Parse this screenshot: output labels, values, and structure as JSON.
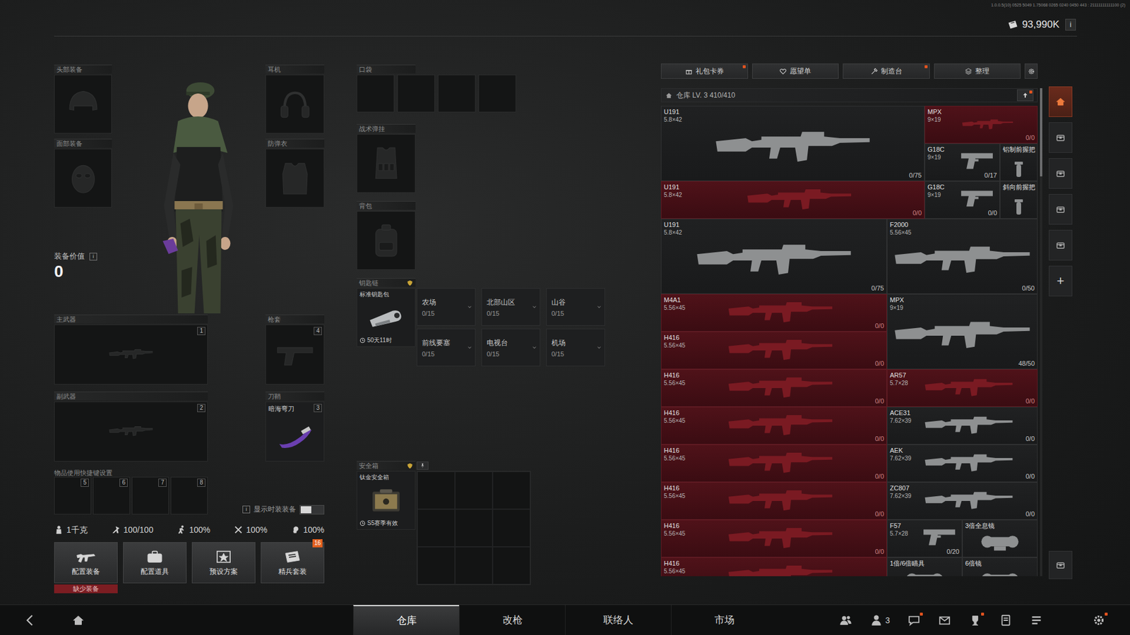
{
  "header": {
    "build": "1.0.0.5(10) 0525 5049 1.75068 0265 0240 0450 443 : 21111111111100 (2)",
    "currency": "93,990K",
    "info": "i"
  },
  "loadout": {
    "gear_slots": [
      {
        "label": "头部装备",
        "kind": "helmet"
      },
      {
        "label": "耳机",
        "kind": "headset"
      },
      {
        "label": "面部装备",
        "kind": "mask"
      },
      {
        "label": "防弹衣",
        "kind": "armor"
      }
    ],
    "value_label": "装备价值",
    "value_info": "i",
    "value": "0",
    "weapon_slots": [
      {
        "label": "主武器",
        "key": "1"
      },
      {
        "label": "副武器",
        "key": "2"
      }
    ],
    "side_slots": [
      {
        "label": "枪套",
        "key": "4",
        "kind": "pistol",
        "filled": false
      },
      {
        "label": "刀鞘",
        "key": "3",
        "kind": "knife",
        "filled": true,
        "item": "暗海弯刀"
      }
    ],
    "hotkeys": {
      "label": "物品使用快捷键设置",
      "keys": [
        "5",
        "6",
        "7",
        "8"
      ]
    },
    "skin_toggle": {
      "info": "i",
      "label": "显示时装装备",
      "on": false
    },
    "stats": [
      {
        "kind": "weight",
        "value": "1千克"
      },
      {
        "kind": "stamina",
        "value": "100/100"
      },
      {
        "kind": "run",
        "value": "100%"
      },
      {
        "kind": "hands",
        "value": "100%"
      },
      {
        "kind": "hearing",
        "value": "100%"
      }
    ],
    "actions": [
      {
        "label": "配置装备",
        "kind": "gun",
        "warning": "缺少装备"
      },
      {
        "label": "配置道具",
        "kind": "kit"
      },
      {
        "label": "预设方案",
        "kind": "preset"
      },
      {
        "label": "精兵套装",
        "kind": "card",
        "badge": "16"
      }
    ]
  },
  "containers": {
    "pocket": {
      "label": "口袋",
      "slots": [
        {
          "filled": false
        },
        {
          "filled": false
        },
        {
          "filled": false
        },
        {
          "filled": false
        }
      ]
    },
    "rig": {
      "label": "战术弹挂",
      "filled": false
    },
    "backpack": {
      "label": "背包",
      "filled": false
    },
    "keychain": {
      "label": "钥匙链",
      "item": "标准钥匙包",
      "timer": "50天11时",
      "compartments": [
        {
          "name": "农场",
          "count": "0/15"
        },
        {
          "name": "北部山区",
          "count": "0/15"
        },
        {
          "name": "山谷",
          "count": "0/15"
        },
        {
          "name": "前线要塞",
          "count": "0/15"
        },
        {
          "name": "电视台",
          "count": "0/15"
        },
        {
          "name": "机场",
          "count": "0/15"
        }
      ]
    },
    "safebox": {
      "label": "安全箱",
      "item": "钛金安全箱",
      "validity": "S5赛季有效",
      "cells": [
        {
          "filled": false
        },
        {
          "filled": false
        },
        {
          "filled": false
        },
        {
          "filled": false
        },
        {
          "filled": false
        },
        {
          "filled": false
        },
        {
          "filled": false
        },
        {
          "filled": false
        },
        {
          "filled": false
        }
      ]
    }
  },
  "warehouse": {
    "toolbar": [
      {
        "label": "礼包卡券",
        "kind": "gift",
        "dot": true
      },
      {
        "label": "愿望单",
        "kind": "heart",
        "dot": false
      },
      {
        "label": "制造台",
        "kind": "craft",
        "dot": true
      },
      {
        "label": "整理",
        "kind": "sort",
        "dot": false
      }
    ],
    "title": "仓库 LV. 3 410/410",
    "upgrade_dot": true,
    "items": [
      {
        "name": "U191",
        "caliber": "5.8×42",
        "count": "0/75",
        "kind": "rifle",
        "flagged": false
      },
      {
        "name": "MPX",
        "caliber": "9×19",
        "count": "0/0",
        "kind": "smg",
        "flagged": true
      },
      {
        "name": "G18C",
        "caliber": "9×19",
        "count": "0/17",
        "kind": "pistol",
        "flagged": false
      },
      {
        "name": "铝制前握把",
        "kind": "grip",
        "flagged": false
      },
      {
        "name": "U191",
        "caliber": "5.8×42",
        "count": "0/0",
        "kind": "rifle",
        "flagged": true
      },
      {
        "name": "G18C",
        "caliber": "9×19",
        "count": "0/0",
        "kind": "pistol",
        "flagged": false
      },
      {
        "name": "斜向前握把",
        "kind": "grip",
        "flagged": false
      },
      {
        "name": "U191",
        "caliber": "5.8×42",
        "count": "0/75",
        "kind": "rifle",
        "flagged": false
      },
      {
        "name": "F2000",
        "caliber": "5.56×45",
        "count": "0/50",
        "kind": "rifle",
        "flagged": false
      },
      {
        "name": "M4A1",
        "caliber": "5.56×45",
        "count": "0/0",
        "kind": "rifle",
        "flagged": true
      },
      {
        "name": "MPX",
        "caliber": "9×19",
        "count": "48/50",
        "kind": "smg",
        "flagged": false
      },
      {
        "name": "H416",
        "caliber": "5.56×45",
        "count": "0/0",
        "kind": "rifle",
        "flagged": true
      },
      {
        "name": "H416",
        "caliber": "5.56×45",
        "count": "0/0",
        "kind": "rifle",
        "flagged": true
      },
      {
        "name": "AR57",
        "caliber": "5.7×28",
        "count": "0/0",
        "kind": "smg",
        "flagged": true
      },
      {
        "name": "H416",
        "caliber": "5.56×45",
        "count": "0/0",
        "kind": "rifle",
        "flagged": true
      },
      {
        "name": "ACE31",
        "caliber": "7.62×39",
        "count": "0/0",
        "kind": "rifle",
        "flagged": false
      },
      {
        "name": "H416",
        "caliber": "5.56×45",
        "count": "0/0",
        "kind": "rifle",
        "flagged": true
      },
      {
        "name": "AEK",
        "caliber": "7.62×39",
        "count": "0/0",
        "kind": "rifle",
        "flagged": false
      },
      {
        "name": "H416",
        "caliber": "5.56×45",
        "count": "0/0",
        "kind": "rifle",
        "flagged": true
      },
      {
        "name": "ZC807",
        "caliber": "7.62×39",
        "count": "0/0",
        "kind": "rifle",
        "flagged": false
      },
      {
        "name": "H416",
        "caliber": "5.56×45",
        "count": "0/0",
        "kind": "rifle",
        "flagged": true
      },
      {
        "name": "F57",
        "caliber": "5.7×28",
        "count": "0/20",
        "kind": "pistol",
        "flagged": false
      },
      {
        "name": "3倍全息镜",
        "kind": "scope",
        "flagged": false
      },
      {
        "name": "H416",
        "caliber": "5.56×45",
        "kind": "rifle",
        "flagged": true
      },
      {
        "name": "1倍/6倍瞄具",
        "kind": "scope",
        "flagged": false
      },
      {
        "name": "6倍镜",
        "kind": "scope",
        "flagged": false
      }
    ]
  },
  "rail": [
    {
      "kind": "home",
      "selected": true
    },
    {
      "kind": "box",
      "selected": false
    },
    {
      "kind": "box",
      "selected": false
    },
    {
      "kind": "box",
      "selected": false
    },
    {
      "kind": "box",
      "selected": false
    },
    {
      "kind": "add",
      "selected": false,
      "glyph": "+"
    }
  ],
  "nav": {
    "tabs": [
      {
        "label": "仓库",
        "selected": true
      },
      {
        "label": "改枪",
        "selected": false
      },
      {
        "label": "联络人",
        "selected": false
      },
      {
        "label": "市场",
        "selected": false
      }
    ],
    "icons": [
      {
        "kind": "friends",
        "dot": false
      },
      {
        "kind": "team",
        "dot": false,
        "count": "3"
      },
      {
        "kind": "chat",
        "dot": true
      },
      {
        "kind": "mail",
        "dot": false
      },
      {
        "kind": "trophy",
        "dot": true
      },
      {
        "kind": "book",
        "dot": false
      },
      {
        "kind": "tasks",
        "dot": false
      },
      {
        "kind": "settings",
        "dot": true
      }
    ]
  }
}
